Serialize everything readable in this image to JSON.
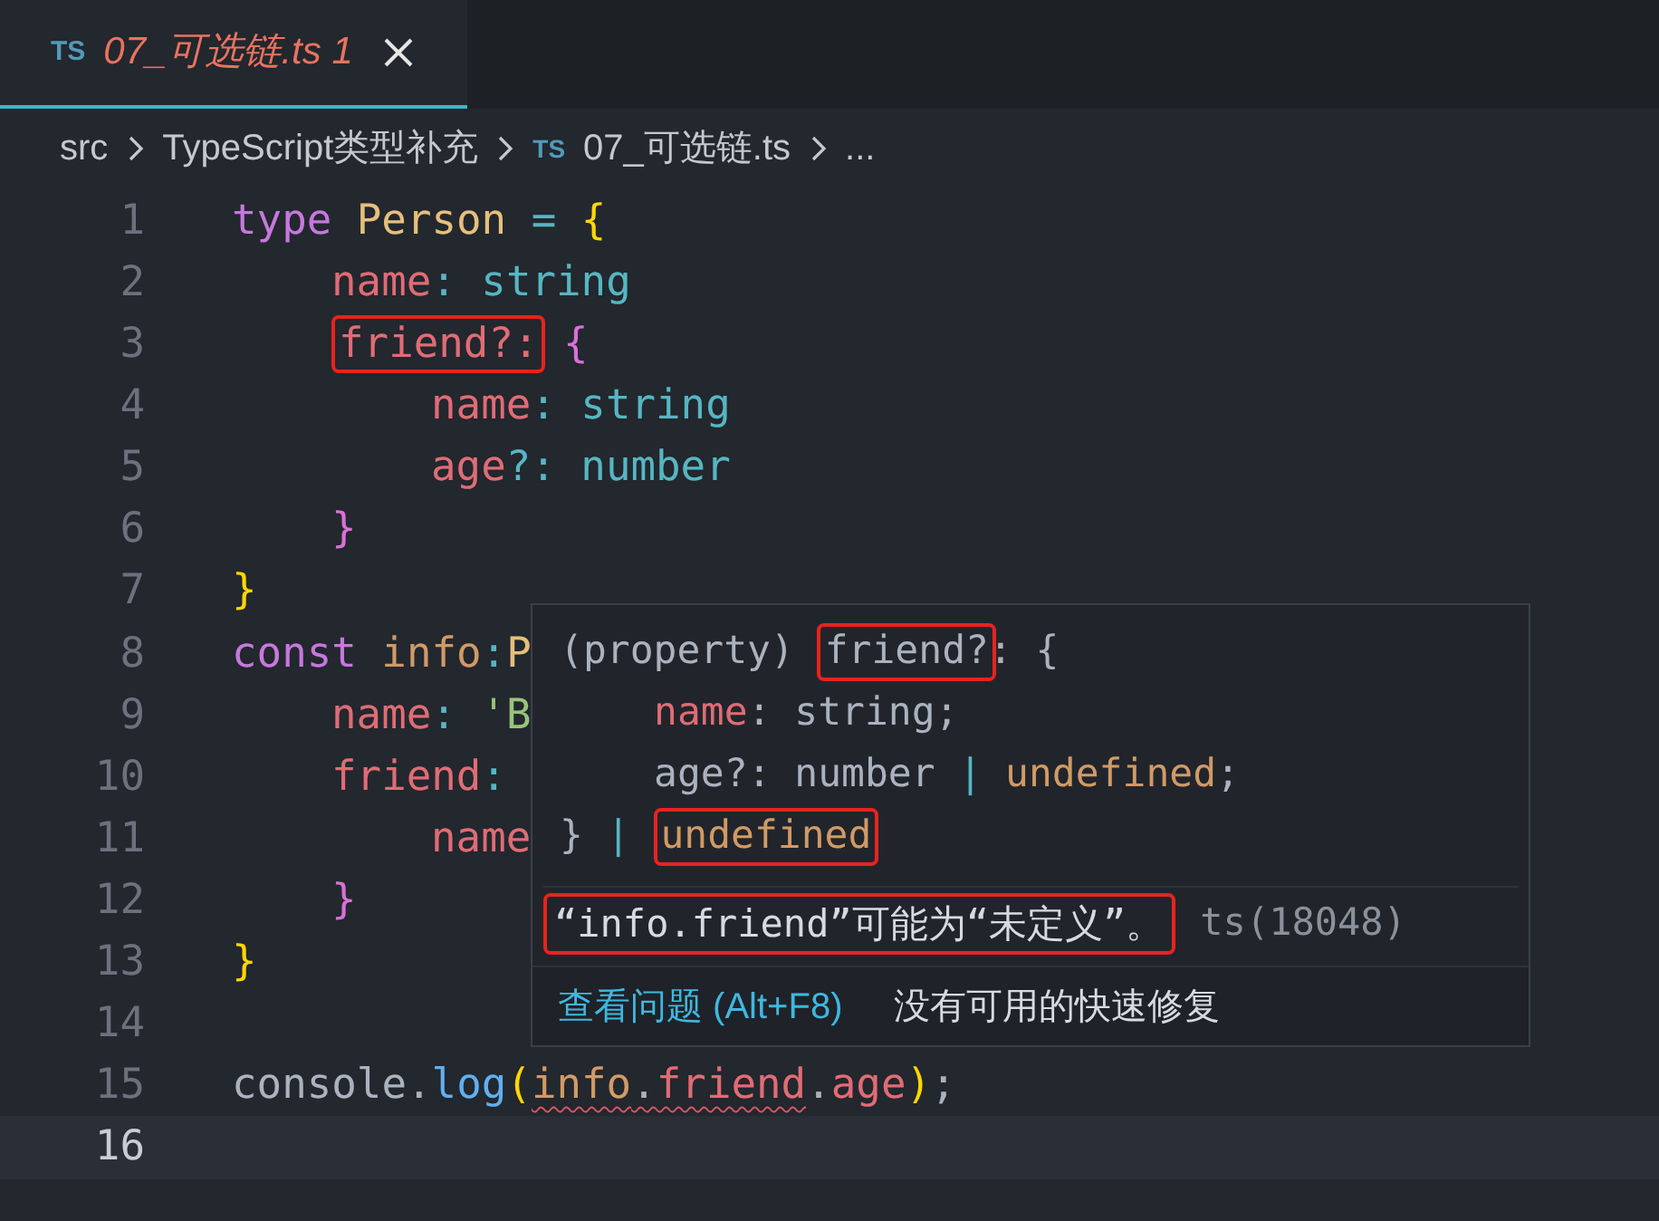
{
  "tab": {
    "icon_text": "TS",
    "title": "07_可选链.ts",
    "problem_count": "1",
    "selected": true
  },
  "breadcrumb": [
    {
      "kind": "text",
      "text": "src"
    },
    {
      "kind": "text",
      "text": "TypeScript类型补充"
    },
    {
      "kind": "file",
      "icon_text": "TS",
      "text": "07_可选链.ts"
    },
    {
      "kind": "text",
      "text": "..."
    }
  ],
  "lines": [
    {
      "number": "1",
      "current": false,
      "tokens": [
        {
          "text": "type",
          "kind": "keyword"
        },
        {
          "text": "Person",
          "kind": "type",
          "space_before": true
        },
        {
          "text": "=",
          "kind": "punct",
          "space_before": true
        },
        {
          "text": "{",
          "kind": "brace1",
          "space_before": true
        }
      ],
      "children": [
        {
          "number": "2",
          "current": false,
          "tokens": [
            {
              "text": "name",
              "kind": "prop"
            },
            {
              "text": ":",
              "kind": "punct"
            },
            {
              "text": "string",
              "kind": "builtin",
              "space_before": true
            }
          ]
        },
        {
          "number": "3",
          "current": false,
          "tokens": [
            {
              "text": "friend?:",
              "kind": "prop",
              "boxed": true
            },
            {
              "text": "{",
              "kind": "brace2",
              "space_before": true
            }
          ],
          "children": [
            {
              "number": "4",
              "current": false,
              "tokens": [
                {
                  "text": "name",
                  "kind": "prop"
                },
                {
                  "text": ":",
                  "kind": "punct"
                },
                {
                  "text": "string",
                  "kind": "builtin",
                  "space_before": true
                }
              ]
            },
            {
              "number": "5",
              "current": false,
              "tokens": [
                {
                  "text": "age",
                  "kind": "prop"
                },
                {
                  "text": "?:",
                  "kind": "punct"
                },
                {
                  "text": "number",
                  "kind": "builtin",
                  "space_before": true
                }
              ]
            }
          ]
        },
        {
          "number": "6",
          "current": false,
          "tokens": [
            {
              "text": "}",
              "kind": "brace2"
            }
          ]
        }
      ]
    },
    {
      "number": "7",
      "current": false,
      "tokens": [
        {
          "text": "}",
          "kind": "brace1"
        }
      ]
    },
    {
      "number": "8",
      "current": false,
      "tokens": [
        {
          "text": "const",
          "kind": "keyword"
        },
        {
          "text": "info",
          "kind": "var",
          "space_before": true
        },
        {
          "text": ":",
          "kind": "punct"
        },
        {
          "text": "P",
          "kind": "type"
        }
      ],
      "children": [
        {
          "number": "9",
          "current": false,
          "tokens": [
            {
              "text": "name",
              "kind": "prop"
            },
            {
              "text": ":",
              "kind": "punct"
            },
            {
              "text": "'B",
              "kind": "string",
              "space_before": true
            }
          ]
        },
        {
          "number": "10",
          "current": false,
          "tokens": [
            {
              "text": "friend",
              "kind": "prop"
            },
            {
              "text": ":",
              "kind": "punct"
            }
          ],
          "children": [
            {
              "number": "11",
              "current": false,
              "tokens": [
                {
                  "text": "name",
                  "kind": "prop"
                }
              ]
            }
          ]
        },
        {
          "number": "12",
          "current": false,
          "tokens": [
            {
              "text": "}",
              "kind": "brace2"
            }
          ]
        }
      ]
    },
    {
      "number": "13",
      "current": false,
      "tokens": [
        {
          "text": "}",
          "kind": "brace1"
        }
      ]
    },
    {
      "number": "14",
      "current": false
    },
    {
      "number": "15",
      "current": false,
      "tokens": [
        {
          "text": "console",
          "kind": "plain"
        },
        {
          "text": ".",
          "kind": "plain"
        },
        {
          "text": "log",
          "kind": "fn"
        },
        {
          "text": "(",
          "kind": "brace1"
        },
        {
          "text": "info",
          "kind": "var",
          "squiggle": true
        },
        {
          "text": ".",
          "kind": "plain",
          "squiggle": true
        },
        {
          "text": "friend",
          "kind": "prop",
          "squiggle": true
        },
        {
          "text": ".",
          "kind": "plain"
        },
        {
          "text": "age",
          "kind": "prop"
        },
        {
          "text": ")",
          "kind": "brace1"
        },
        {
          "text": ";",
          "kind": "plain"
        }
      ]
    },
    {
      "number": "16",
      "current": true
    }
  ],
  "hover": {
    "signature": [
      {
        "tokens": [
          {
            "text": "(property)",
            "kind": "plain"
          },
          {
            "text": "friend?",
            "kind": "plain",
            "boxed": true,
            "space_before": true
          },
          {
            "text": ":",
            "kind": "plain"
          },
          {
            "text": "{",
            "kind": "plain",
            "space_before": true
          }
        ],
        "children": [
          {
            "tokens": [
              {
                "text": "name",
                "kind": "prop"
              },
              {
                "text": ":",
                "kind": "plain"
              },
              {
                "text": "string;",
                "kind": "plain",
                "space_before": true
              }
            ]
          },
          {
            "tokens": [
              {
                "text": "age?:",
                "kind": "plain"
              },
              {
                "text": "number",
                "kind": "plain",
                "space_before": true
              },
              {
                "text": "|",
                "kind": "builtin",
                "space_before": true
              },
              {
                "text": "undefined",
                "kind": "var",
                "space_before": true
              },
              {
                "text": ";",
                "kind": "plain"
              }
            ]
          }
        ]
      },
      {
        "tokens": [
          {
            "text": "}",
            "kind": "plain"
          },
          {
            "text": "|",
            "kind": "builtin",
            "space_before": true
          },
          {
            "text": "undefined",
            "kind": "var",
            "boxed": true,
            "space_before": true
          }
        ]
      }
    ],
    "message": {
      "text": "“info.friend”可能为“未定义”。",
      "boxed": true
    },
    "code": "ts(18048)",
    "view_problem_link": "查看问题 (Alt+F8)",
    "quick_fix_note": "没有可用的快速修复"
  }
}
